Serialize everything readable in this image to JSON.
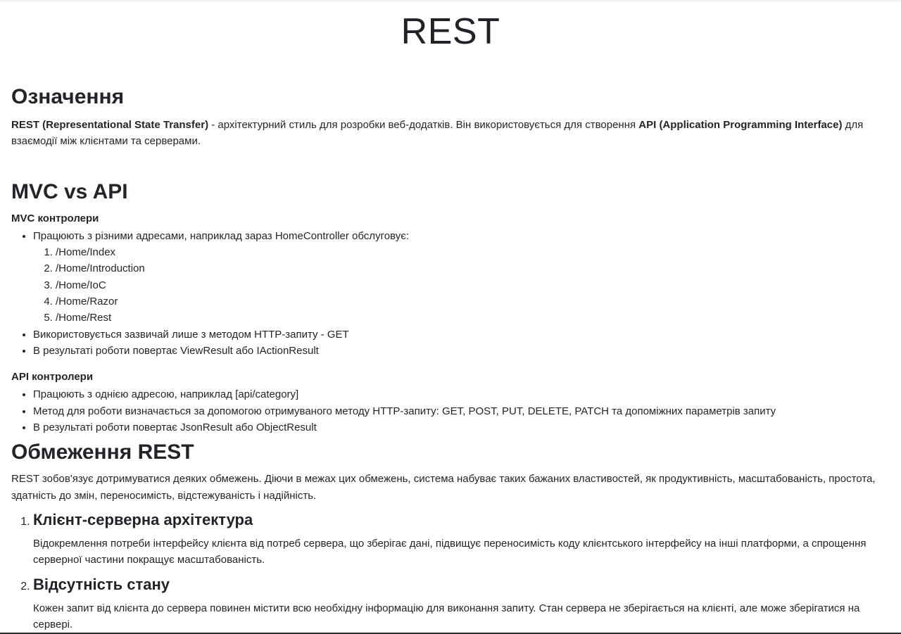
{
  "page": {
    "title": "REST"
  },
  "meaning": {
    "heading": "Означення",
    "term1": "REST (Representational State Transfer)",
    "text1": " - архітектурний стиль для розробки веб-додатків. Він використовується для створення ",
    "term2": "API (Application Programming Interface)",
    "text2": " для взаємодії між клієнтами та серверами."
  },
  "mvc_vs_api": {
    "heading": "MVC vs API",
    "mvc": {
      "title": "MVC контролери",
      "items": [
        "Працюють з різними адресами, наприклад зараз HomeController обслуговує:",
        "Використовується зазвичай лише з методом HTTP-запиту - GET",
        "В результаті роботи повертає ViewResult або IActionResult"
      ],
      "routes": [
        "/Home/Index",
        "/Home/Introduction",
        "/Home/IoC",
        "/Home/Razor",
        "/Home/Rest"
      ]
    },
    "api": {
      "title": "API контролери",
      "items": [
        "Працюють з однією адресою, наприклад [api/category]",
        "Метод для роботи визначається за допомогою отримуваного методу HTTP-запиту: GET, POST, PUT, DELETE, PATCH та допоміжних параметрів запиту",
        "В результаті роботи повертає JsonResult або ObjectResult"
      ]
    }
  },
  "limits": {
    "heading": "Обмеження REST",
    "intro": "REST зобов'язує дотримуватися деяких обмежень. Діючи в межах цих обмежень, система набуває таких бажаних властивостей, як продуктивність, масштабованість, простота, здатність до змін, переносимість, відстежуваність і надійність.",
    "principles": [
      {
        "title": "Клієнт-серверна архітектура",
        "desc": "Відокремлення потреби інтерфейсу клієнта від потреб сервера, що зберігає дані, підвищує переносимість коду клієнтського інтерфейсу на інші платформи, а спрощення серверної частини покращує масштабованість."
      },
      {
        "title": "Відсутність стану",
        "desc": "Кожен запит від клієнта до сервера повинен містити всю необхідну інформацію для виконання запиту. Стан сервера не зберігається на клієнті, але може зберігатися на сервері."
      }
    ]
  }
}
